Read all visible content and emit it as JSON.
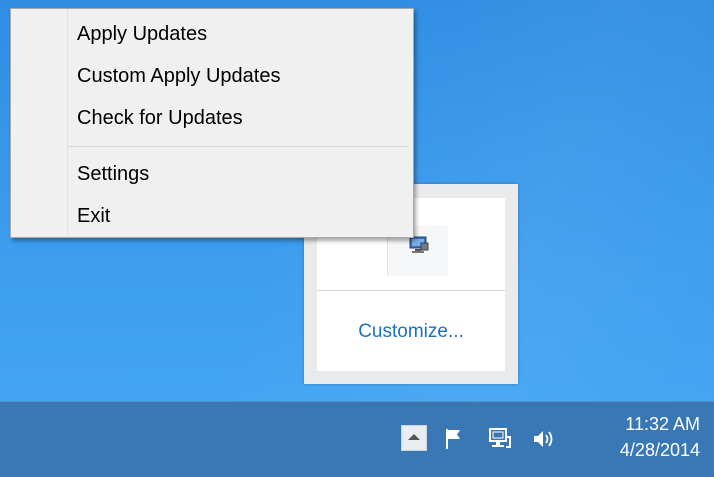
{
  "context_menu": {
    "items": [
      {
        "label": "Apply Updates"
      },
      {
        "label": "Custom Apply Updates"
      },
      {
        "label": "Check for Updates"
      },
      {
        "label": "Settings"
      },
      {
        "label": "Exit"
      }
    ]
  },
  "tray_flyout": {
    "customize_label": "Customize...",
    "icons": [
      "update-app-icon"
    ]
  },
  "taskbar": {
    "tray_icons": [
      "show-hidden-icons-button",
      "action-center-flag-icon",
      "network-icon",
      "volume-icon"
    ],
    "clock": {
      "time": "11:32 AM",
      "date": "4/28/2014"
    }
  },
  "colors": {
    "desktop": "#3d9ef0",
    "taskbar": "#3a78b5",
    "menu_bg": "#f0f0f0",
    "link": "#1e6fbf"
  }
}
